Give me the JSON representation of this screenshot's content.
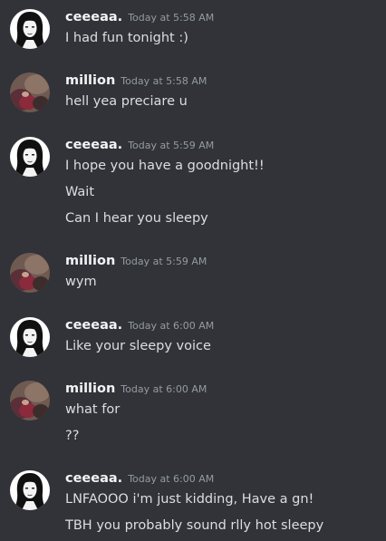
{
  "messages": [
    {
      "author": "ceeeaa.",
      "avatar_icon": "ceeeaa-avatar-icon",
      "time": "Today at 5:58 AM",
      "lines": [
        "I had fun tonight :)"
      ]
    },
    {
      "author": "million",
      "avatar_icon": "million-avatar-icon",
      "time": "Today at 5:58 AM",
      "lines": [
        "hell yea preciare u"
      ]
    },
    {
      "author": "ceeeaa.",
      "avatar_icon": "ceeeaa-avatar-icon",
      "time": "Today at 5:59 AM",
      "lines": [
        "I hope you have a goodnight!!",
        "Wait",
        "Can I hear you sleepy"
      ]
    },
    {
      "author": "million",
      "avatar_icon": "million-avatar-icon",
      "time": "Today at 5:59 AM",
      "lines": [
        "wym"
      ]
    },
    {
      "author": "ceeeaa.",
      "avatar_icon": "ceeeaa-avatar-icon",
      "time": "Today at 6:00 AM",
      "lines": [
        "Like your sleepy voice"
      ]
    },
    {
      "author": "million",
      "avatar_icon": "million-avatar-icon",
      "time": "Today at 6:00 AM",
      "lines": [
        "what for",
        "??"
      ]
    },
    {
      "author": "ceeeaa.",
      "avatar_icon": "ceeeaa-avatar-icon",
      "time": "Today at 6:00 AM",
      "lines": [
        "LNFAOOO i'm just kidding, Have a gn!",
        "TBH you probably sound rlly hot sleepy"
      ]
    }
  ],
  "colors": {
    "background": "#313338",
    "username": "#f2f3f5",
    "timestamp": "#949ba4",
    "message_text": "#dbdee1"
  }
}
